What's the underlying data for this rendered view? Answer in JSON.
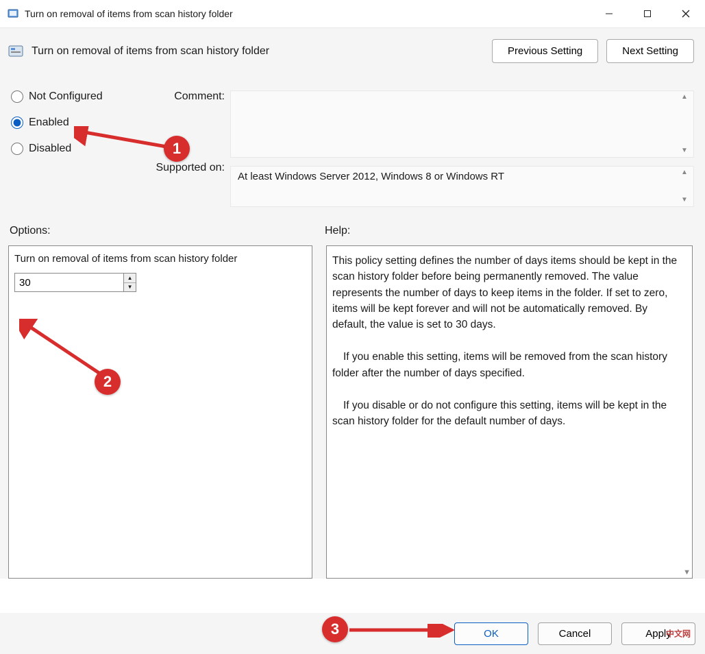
{
  "window": {
    "title": "Turn on removal of items from scan history folder"
  },
  "header": {
    "title": "Turn on removal of items from scan history folder",
    "prev_button": "Previous Setting",
    "next_button": "Next Setting"
  },
  "config": {
    "not_configured_label": "Not Configured",
    "enabled_label": "Enabled",
    "disabled_label": "Disabled",
    "selected": "enabled",
    "comment_label": "Comment:",
    "comment_value": "",
    "supported_label": "Supported on:",
    "supported_value": "At least Windows Server 2012, Windows 8 or Windows RT"
  },
  "sections": {
    "options_label": "Options:",
    "help_label": "Help:"
  },
  "options": {
    "title": "Turn on removal of items from scan history folder",
    "days_value": "30"
  },
  "help": {
    "p1": "This policy setting defines the number of days items should be kept in the scan history folder before being permanently removed. The value represents the number of days to keep items in the folder. If set to zero, items will be kept forever and will not be automatically removed. By default, the value is set to 30 days.",
    "p2": "If you enable this setting, items will be removed from the scan history folder after the number of days specified.",
    "p3": "If you disable or do not configure this setting, items will be kept in the scan history folder for the default number of days."
  },
  "footer": {
    "ok": "OK",
    "cancel": "Cancel",
    "apply": "Apply"
  },
  "annotations": {
    "b1": "1",
    "b2": "2",
    "b3": "3",
    "watermark": "中文网"
  }
}
